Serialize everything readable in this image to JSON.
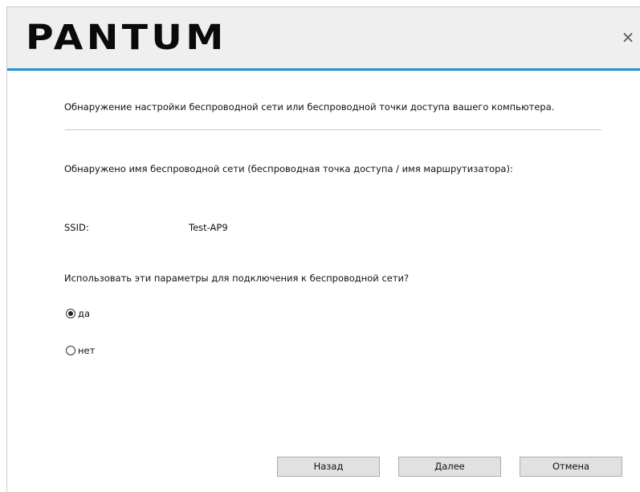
{
  "header": {
    "logo_text": "PANTUM",
    "close_glyph": "×",
    "accent_color": "#1f94d8"
  },
  "content": {
    "detect_text": "Обнаружение настройки беспроводной сети или беспроводной точки доступа вашего компьютера.",
    "found_text": "Обнаружено имя беспроводной сети (беспроводная точка доступа / имя маршрутизатора):",
    "ssid_label": "SSID:",
    "ssid_value": "Test-AP9",
    "question": "Использовать эти параметры для подключения к беспроводной сети?",
    "options": [
      {
        "label": "да",
        "selected": true
      },
      {
        "label": "нет",
        "selected": false
      }
    ]
  },
  "buttons": {
    "back": "Назад",
    "next": "Далее",
    "cancel": "Отмена"
  }
}
